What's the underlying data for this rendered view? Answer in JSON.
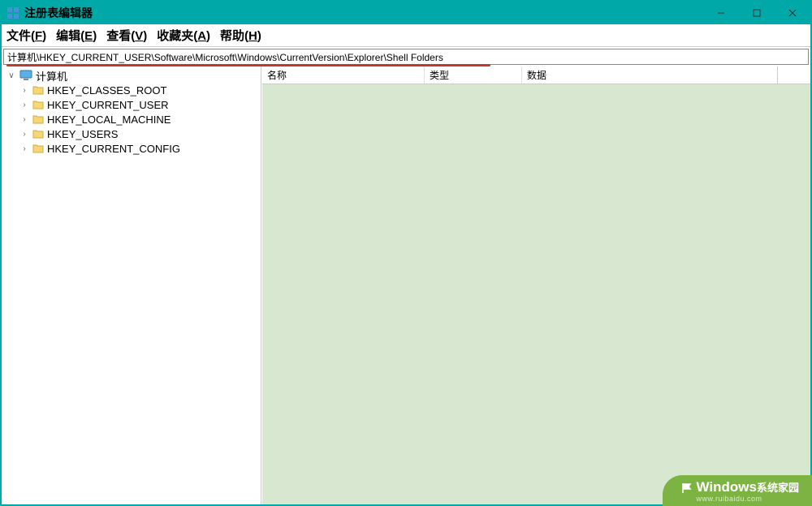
{
  "titlebar": {
    "title": "注册表编辑器"
  },
  "menubar": {
    "file": "文件(F)",
    "edit": "编辑(E)",
    "view": "查看(V)",
    "favorites": "收藏夹(A)",
    "help": "帮助(H)"
  },
  "address": {
    "path": "计算机\\HKEY_CURRENT_USER\\Software\\Microsoft\\Windows\\CurrentVersion\\Explorer\\Shell Folders"
  },
  "tree": {
    "root": "计算机",
    "items": [
      "HKEY_CLASSES_ROOT",
      "HKEY_CURRENT_USER",
      "HKEY_LOCAL_MACHINE",
      "HKEY_USERS",
      "HKEY_CURRENT_CONFIG"
    ]
  },
  "columns": {
    "name": "名称",
    "type": "类型",
    "data": "数据"
  },
  "watermark": {
    "brand_prefix": "W",
    "brand": "indows",
    "brand_suffix": "系统家园",
    "url": "www.ruibaidu.com"
  }
}
